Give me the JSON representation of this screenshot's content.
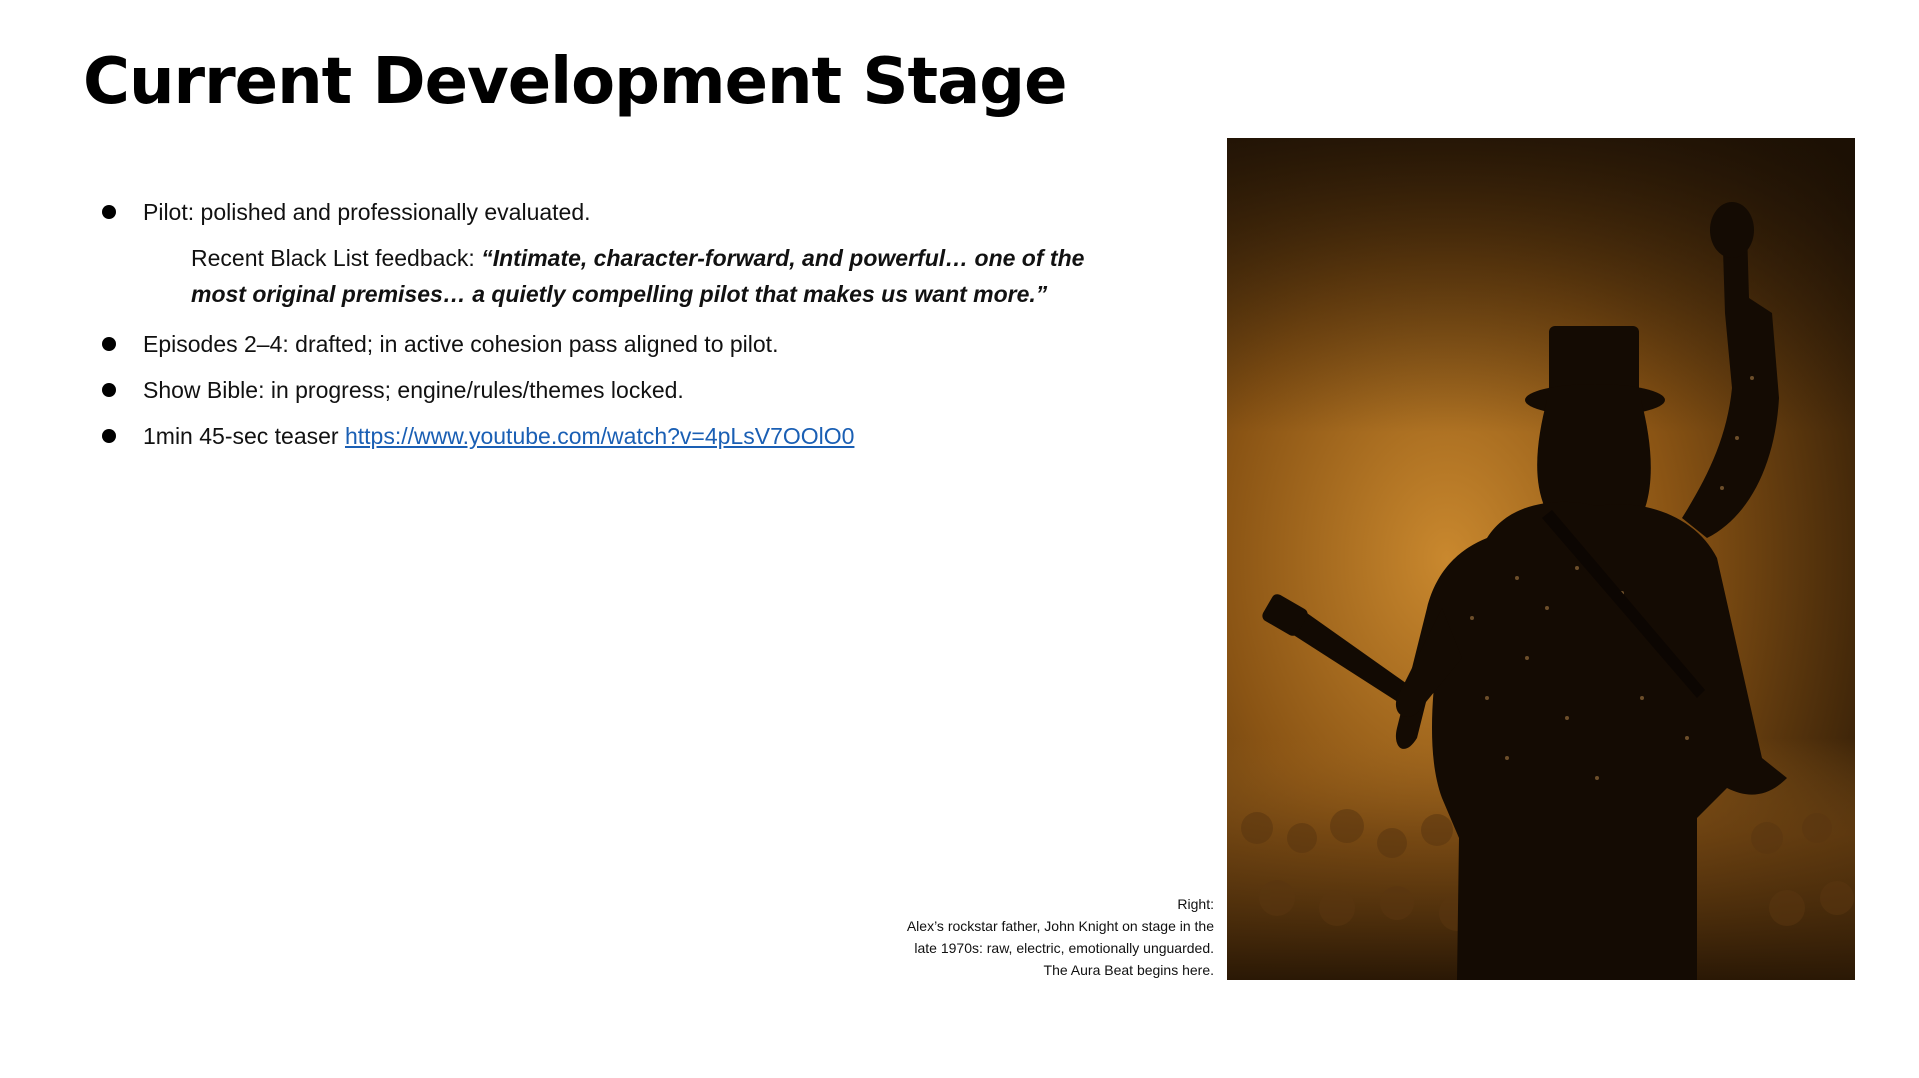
{
  "slide": {
    "title": "Current Development Stage",
    "bullet_1": "Pilot: polished and professionally evaluated.",
    "feedback_label": "Recent Black List feedback: ",
    "feedback_quote": "“Intimate, character-forward, and powerful… one of the most original premises… a quietly compelling pilot that makes us want more.”",
    "bullet_2": "Episodes 2–4: drafted; in active cohesion pass aligned to pilot.",
    "bullet_3": "Show Bible: in progress; engine/rules/themes locked.",
    "bullet_4_prefix": "1min 45-sec teaser ",
    "bullet_4_link": "https://www.youtube.com/watch?v=4pLsV7OOlO0",
    "caption": {
      "line_1": "Right:",
      "line_2": "Alex’s rockstar father, John Knight on stage in the",
      "line_3": "late 1970s:  raw, electric, emotionally unguarded.",
      "line_4": "The Aura Beat begins here."
    }
  },
  "colors": {
    "link": "#1a5fb4",
    "photo_glow": "#b97a28",
    "photo_dark": "#1a1005"
  }
}
